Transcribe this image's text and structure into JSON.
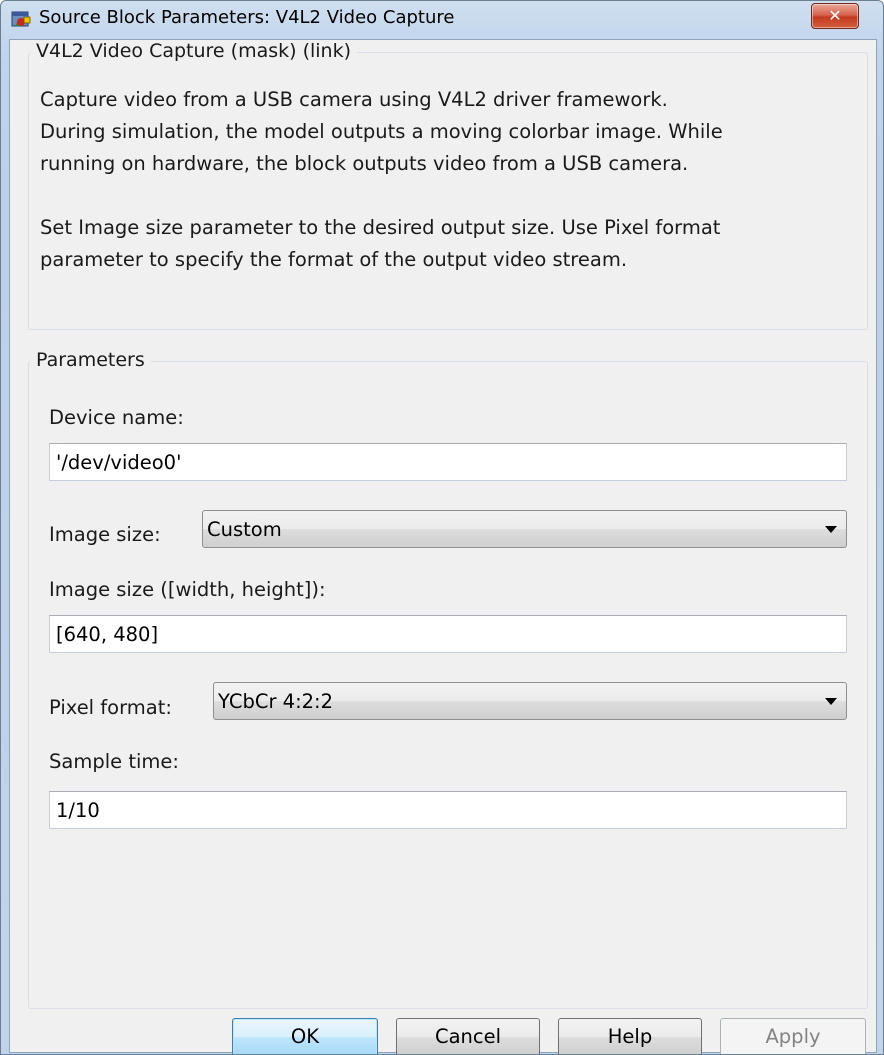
{
  "window": {
    "title": "Source Block Parameters: V4L2 Video Capture",
    "close_label": "✕"
  },
  "mask_group": {
    "legend": "V4L2 Video Capture (mask) (link)",
    "description_lines": [
      "Capture video from a USB camera using V4L2 driver framework.",
      "During simulation, the model outputs a moving colorbar image. While",
      "running on hardware, the block outputs video from a USB camera.",
      "",
      "Set Image size parameter to the desired output size. Use Pixel format",
      "parameter to specify the format of the output video stream."
    ]
  },
  "parameters": {
    "legend": "Parameters",
    "device_name": {
      "label": "Device name:",
      "value": "'/dev/video0'"
    },
    "image_size": {
      "label": "Image size:",
      "selected": "Custom"
    },
    "image_size_wh": {
      "label": "Image size ([width, height]):",
      "value": "[640, 480]"
    },
    "pixel_format": {
      "label": "Pixel format:",
      "selected": "YCbCr 4:2:2"
    },
    "sample_time": {
      "label": "Sample time:",
      "value": "1/10"
    }
  },
  "buttons": {
    "ok": "OK",
    "cancel": "Cancel",
    "help": "Help",
    "apply": "Apply"
  },
  "icons": {
    "app_icon": "simulink-block-icon",
    "close_icon": "close-icon"
  }
}
